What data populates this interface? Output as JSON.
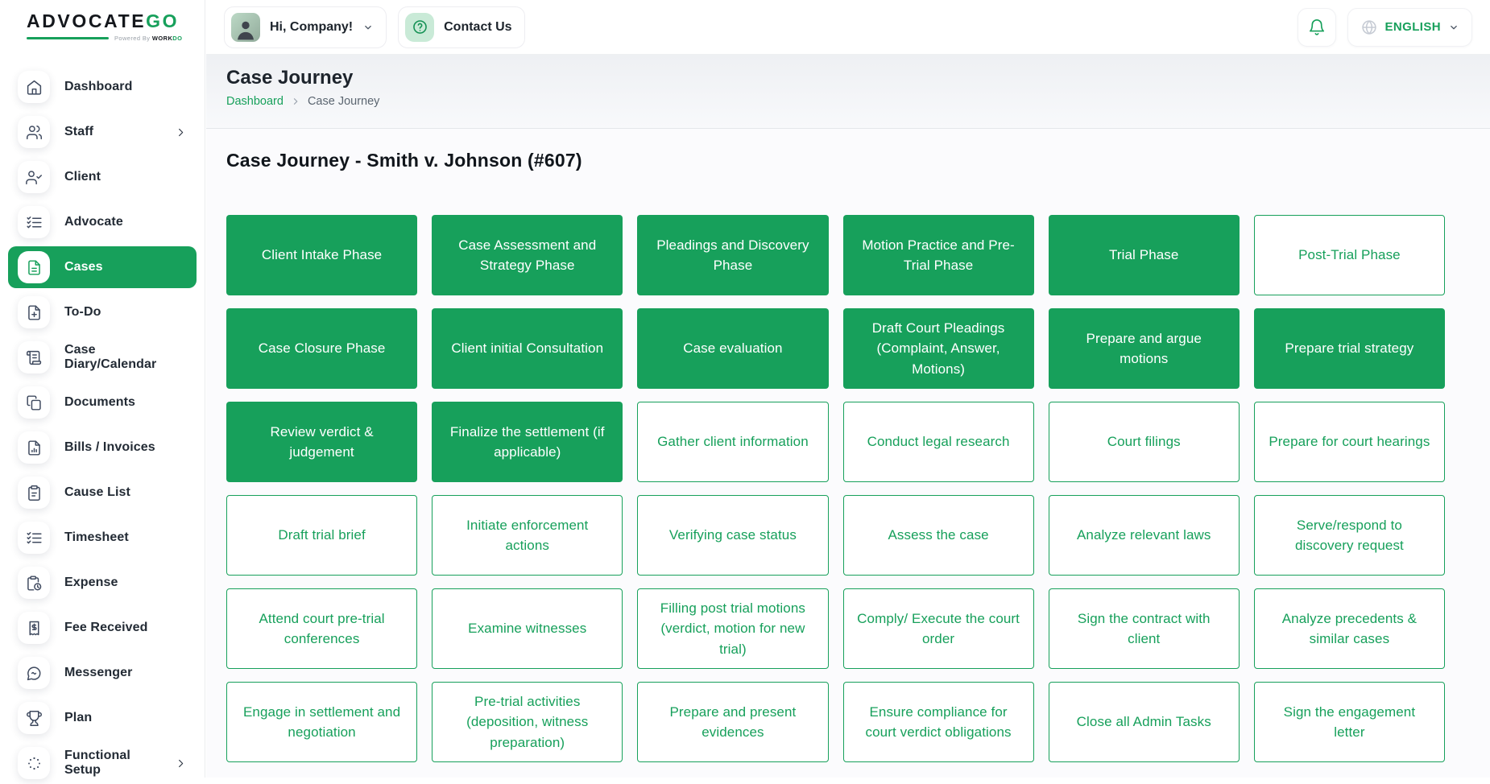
{
  "colors": {
    "primary_green": "#17a05b"
  },
  "brand": {
    "name_dark": "ADVOCATE",
    "name_green": "GO",
    "powered_by": "Powered By",
    "powered_brand_dark": "WORK",
    "powered_brand_green": "DO"
  },
  "topbar": {
    "greeting": "Hi, Company!",
    "greeting_chevron_icon": "chevron-down-icon",
    "avatar_icon": "user-avatar",
    "contact_label": "Contact Us",
    "contact_icon": "help-circle-icon",
    "bell_icon": "bell-icon",
    "globe_icon": "globe-icon",
    "language": "ENGLISH",
    "language_chevron_icon": "chevron-down-icon"
  },
  "sidebar": {
    "items": [
      {
        "label": "Dashboard",
        "icon": "home-icon",
        "active": false,
        "has_submenu": false
      },
      {
        "label": "Staff",
        "icon": "users-icon",
        "active": false,
        "has_submenu": true
      },
      {
        "label": "Client",
        "icon": "user-check-icon",
        "active": false,
        "has_submenu": false
      },
      {
        "label": "Advocate",
        "icon": "checklist-icon",
        "active": false,
        "has_submenu": false
      },
      {
        "label": "Cases",
        "icon": "case-file-icon",
        "active": true,
        "has_submenu": false
      },
      {
        "label": "To-Do",
        "icon": "file-plus-icon",
        "active": false,
        "has_submenu": false
      },
      {
        "label": "Case Diary/Calendar",
        "icon": "diary-icon",
        "active": false,
        "has_submenu": false
      },
      {
        "label": "Documents",
        "icon": "documents-icon",
        "active": false,
        "has_submenu": false
      },
      {
        "label": "Bills / Invoices",
        "icon": "invoice-icon",
        "active": false,
        "has_submenu": false
      },
      {
        "label": "Cause List",
        "icon": "clipboard-icon",
        "active": false,
        "has_submenu": false
      },
      {
        "label": "Timesheet",
        "icon": "timesheet-icon",
        "active": false,
        "has_submenu": false
      },
      {
        "label": "Expense",
        "icon": "expense-icon",
        "active": false,
        "has_submenu": false
      },
      {
        "label": "Fee Received",
        "icon": "receipt-icon",
        "active": false,
        "has_submenu": false
      },
      {
        "label": "Messenger",
        "icon": "chat-icon",
        "active": false,
        "has_submenu": false
      },
      {
        "label": "Plan",
        "icon": "trophy-icon",
        "active": false,
        "has_submenu": false
      },
      {
        "label": "Functional Setup",
        "icon": "setup-icon",
        "active": false,
        "has_submenu": true
      }
    ]
  },
  "page": {
    "title": "Case Journey",
    "breadcrumb": [
      {
        "label": "Dashboard",
        "link": true
      },
      {
        "label": "Case Journey",
        "link": false
      }
    ],
    "section_title": "Case Journey - Smith v. Johnson (#607)"
  },
  "journey_cards": [
    {
      "label": "Client Intake Phase",
      "variant": "filled"
    },
    {
      "label": "Case Assessment and Strategy Phase",
      "variant": "filled"
    },
    {
      "label": "Pleadings and Discovery Phase",
      "variant": "filled"
    },
    {
      "label": "Motion Practice and Pre-Trial Phase",
      "variant": "filled"
    },
    {
      "label": "Trial Phase",
      "variant": "filled"
    },
    {
      "label": "Post-Trial Phase",
      "variant": "outlined"
    },
    {
      "label": "Case Closure Phase",
      "variant": "filled"
    },
    {
      "label": "Client initial Consultation",
      "variant": "filled"
    },
    {
      "label": "Case evaluation",
      "variant": "filled"
    },
    {
      "label": "Draft Court Pleadings (Complaint, Answer, Motions)",
      "variant": "filled"
    },
    {
      "label": "Prepare and argue motions",
      "variant": "filled"
    },
    {
      "label": "Prepare trial strategy",
      "variant": "filled"
    },
    {
      "label": "Review verdict & judgement",
      "variant": "filled"
    },
    {
      "label": "Finalize the settlement (if applicable)",
      "variant": "filled"
    },
    {
      "label": "Gather client information",
      "variant": "outlined"
    },
    {
      "label": "Conduct legal research",
      "variant": "outlined"
    },
    {
      "label": "Court filings",
      "variant": "outlined"
    },
    {
      "label": "Prepare for court hearings",
      "variant": "outlined"
    },
    {
      "label": "Draft trial brief",
      "variant": "outlined"
    },
    {
      "label": "Initiate enforcement actions",
      "variant": "outlined"
    },
    {
      "label": "Verifying case status",
      "variant": "outlined"
    },
    {
      "label": "Assess the case",
      "variant": "outlined"
    },
    {
      "label": "Analyze relevant laws",
      "variant": "outlined"
    },
    {
      "label": "Serve/respond to discovery request",
      "variant": "outlined"
    },
    {
      "label": "Attend court pre-trial conferences",
      "variant": "outlined"
    },
    {
      "label": "Examine witnesses",
      "variant": "outlined"
    },
    {
      "label": "Filling post trial motions (verdict, motion for new trial)",
      "variant": "outlined"
    },
    {
      "label": "Comply/ Execute the court order",
      "variant": "outlined"
    },
    {
      "label": "Sign the contract with client",
      "variant": "outlined"
    },
    {
      "label": "Analyze precedents & similar cases",
      "variant": "outlined"
    },
    {
      "label": "Engage in settlement and negotiation",
      "variant": "outlined"
    },
    {
      "label": "Pre-trial activities (deposition, witness preparation)",
      "variant": "outlined"
    },
    {
      "label": "Prepare and present evidences",
      "variant": "outlined"
    },
    {
      "label": "Ensure compliance for court verdict obligations",
      "variant": "outlined"
    },
    {
      "label": "Close all Admin Tasks",
      "variant": "outlined"
    },
    {
      "label": "Sign the engagement letter",
      "variant": "outlined"
    }
  ]
}
